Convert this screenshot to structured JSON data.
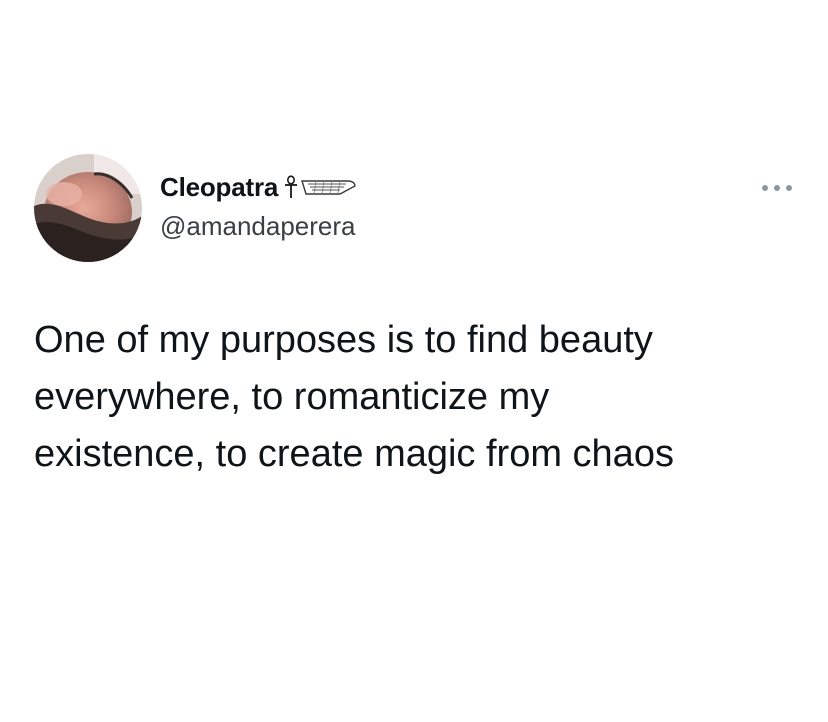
{
  "author": {
    "display_name": "Cleopatra",
    "name_emojis": [
      "ankh-icon",
      "wing-icon"
    ],
    "handle": "@amandaperera"
  },
  "more_menu": {
    "icon": "more-horizontal-icon"
  },
  "tweet": {
    "lines": [
      "One of my purposes is to find beauty",
      "everywhere, to romanticize my",
      "existence, to create magic from chaos"
    ]
  },
  "colors": {
    "background": "#ffffff",
    "text": "#0f1419",
    "handle": "#3a3f44",
    "more_icon": "#8899a6"
  }
}
